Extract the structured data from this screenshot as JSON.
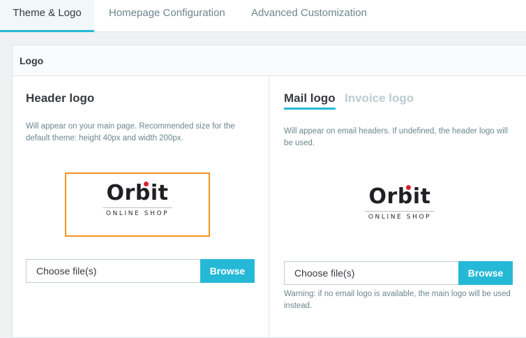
{
  "tabs": [
    {
      "label": "Theme & Logo",
      "active": true
    },
    {
      "label": "Homepage Configuration",
      "active": false
    },
    {
      "label": "Advanced Customization",
      "active": false
    }
  ],
  "card": {
    "title": "Logo"
  },
  "header_logo": {
    "title": "Header logo",
    "help": "Will appear on your main page. Recommended size for the default theme: height 40px and width 200px.",
    "logo_word": "Orbit",
    "logo_sub": "ONLINE SHOP",
    "file_placeholder": "Choose file(s)",
    "browse_label": "Browse"
  },
  "mail_logo": {
    "tabs": [
      {
        "label": "Mail logo",
        "active": true
      },
      {
        "label": "Invoice logo",
        "active": false
      }
    ],
    "help": "Will appear on email headers. If undefined, the header logo will be used.",
    "logo_word": "Orbit",
    "logo_sub": "ONLINE SHOP",
    "file_placeholder": "Choose file(s)",
    "browse_label": "Browse",
    "warning": "Warning: if no email logo is available, the main logo will be used instead."
  },
  "colors": {
    "accent": "#25b9d7",
    "logo_highlight": "#f5921e",
    "logo_dot": "#d62130"
  }
}
